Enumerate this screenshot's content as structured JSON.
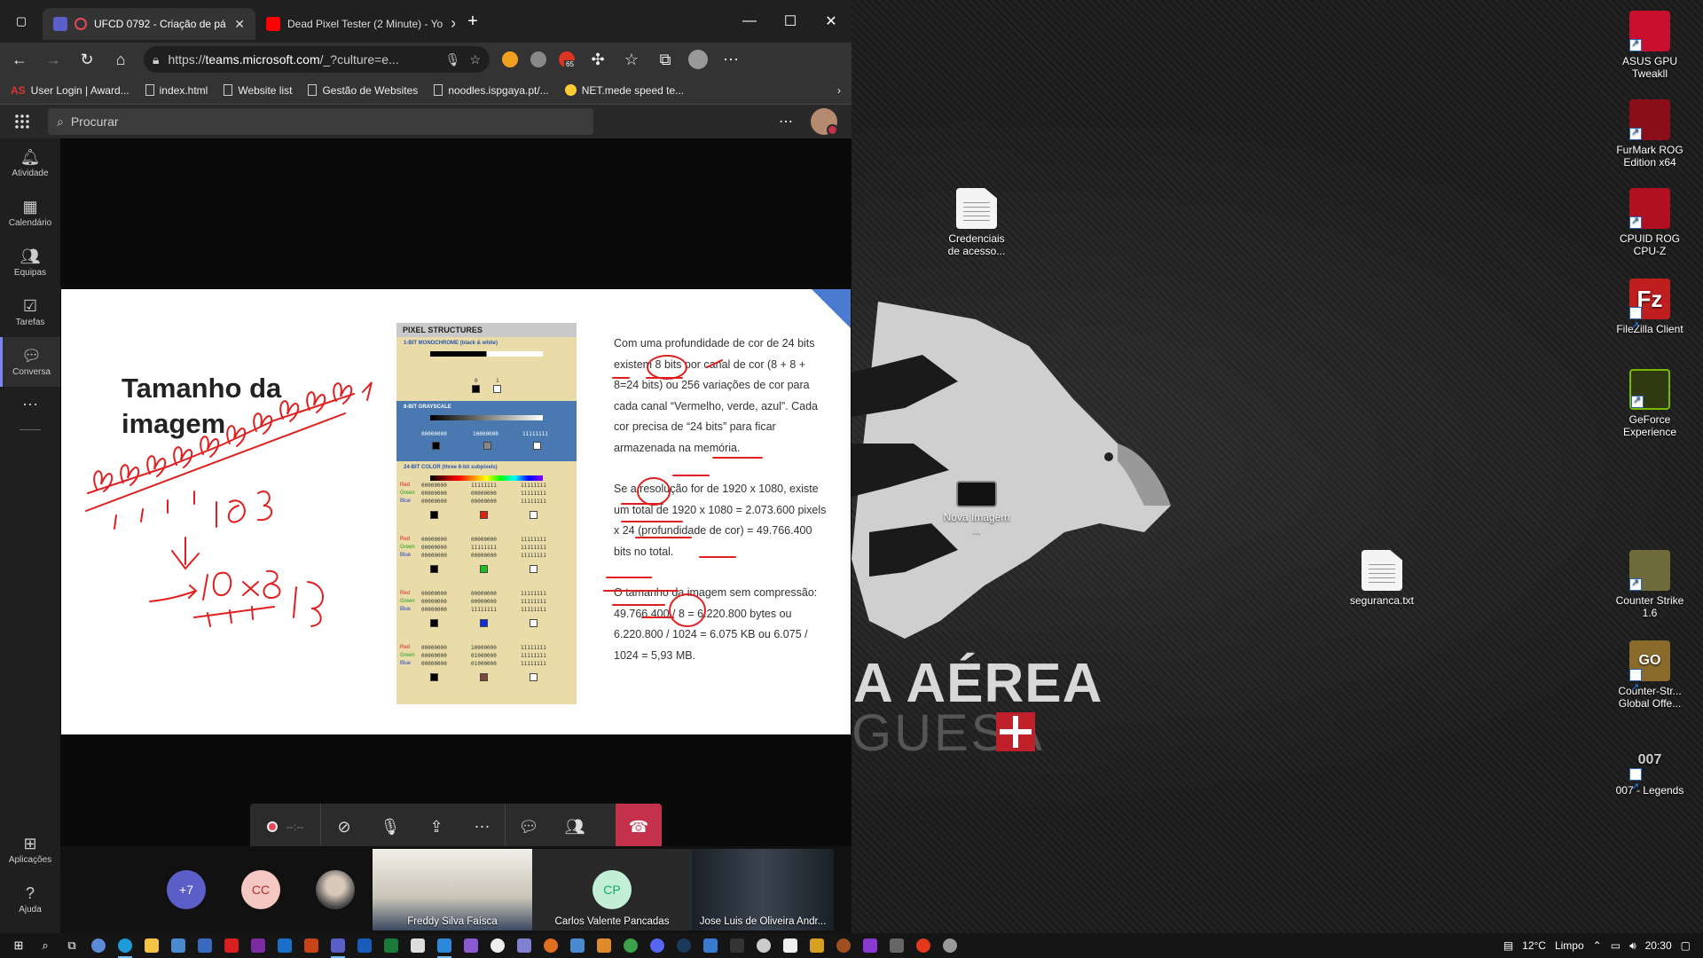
{
  "browser": {
    "tabs": [
      {
        "title": "UFCD 0792 - Criação de pá",
        "active": true
      },
      {
        "title": "Dead Pixel Tester (2 Minute) - Yo",
        "active": false
      }
    ],
    "url_prefix": "https://",
    "url_host": "teams.microsoft.com",
    "url_path": "/_?culture=e...",
    "extension_badge": "65",
    "bookmarks": [
      "User Login | Award...",
      "index.html",
      "Website list",
      "Gestão de Websites",
      "noodles.ispgaya.pt/...",
      "NET.mede speed te..."
    ]
  },
  "teams": {
    "search_placeholder": "Procurar",
    "rail": [
      {
        "label": "Atividade",
        "icon": "bell-icon"
      },
      {
        "label": "Calendário",
        "icon": "calendar-icon"
      },
      {
        "label": "Equipas",
        "icon": "teams-icon"
      },
      {
        "label": "Tarefas",
        "icon": "tasks-icon"
      },
      {
        "label": "Conversa",
        "icon": "chat-icon"
      }
    ],
    "rail_bottom": [
      {
        "label": "Aplicações",
        "icon": "apps-icon"
      },
      {
        "label": "Ajuda",
        "icon": "help-icon"
      }
    ],
    "presenter_name": "Jose Luis de Oliveira Andrade",
    "record_time": "--:--",
    "participants": {
      "overflow": "+7",
      "cc_initials": "CC",
      "cp_initials": "CP",
      "video1_name": "Freddy Silva Faísca",
      "cp_name": "Carlos Valente Pancadas",
      "video2_name": "Jose Luis de Oliveira Andr..."
    }
  },
  "slide": {
    "title": "Tamanho da imagem",
    "pixel_header": "PIXEL STRUCTURES",
    "mono_label": "1-BIT MONOCHROME (black & white)",
    "mono_bits": [
      "0",
      "1"
    ],
    "gray_label": "8-BIT GRAYSCALE",
    "gray_bits": [
      "00000000",
      "10000000",
      "11111111"
    ],
    "color_label": "24-BIT COLOR (three 8-bit subpixels)",
    "channel_labels": [
      "Red",
      "Green",
      "Blue"
    ],
    "color_groups": [
      {
        "cols": [
          [
            "00000000",
            "00000000",
            "00000000"
          ],
          [
            "11111111",
            "00000000",
            "00000000"
          ],
          [
            "11111111",
            "11111111",
            "11111111"
          ]
        ],
        "swatches": [
          "#000000",
          "#e02010",
          "#ffffff"
        ]
      },
      {
        "cols": [
          [
            "00000000",
            "00000000",
            "00000000"
          ],
          [
            "00000000",
            "11111111",
            "00000000"
          ],
          [
            "11111111",
            "11111111",
            "11111111"
          ]
        ],
        "swatches": [
          "#000000",
          "#20c020",
          "#ffffff"
        ]
      },
      {
        "cols": [
          [
            "00000000",
            "00000000",
            "00000000"
          ],
          [
            "00000000",
            "00000000",
            "11111111"
          ],
          [
            "11111111",
            "11111111",
            "11111111"
          ]
        ],
        "swatches": [
          "#000000",
          "#1030e0",
          "#ffffff"
        ]
      },
      {
        "cols": [
          [
            "00000000",
            "00000000",
            "00000000"
          ],
          [
            "10000000",
            "01000000",
            "01000000"
          ],
          [
            "11111111",
            "11111111",
            "11111111"
          ]
        ],
        "swatches": [
          "#000000",
          "#7a4a3a",
          "#ffffff"
        ]
      }
    ],
    "para1": "Com uma profundidade de cor de 24 bits existem 8 bits por canal de cor (8 + 8 + 8=24 bits) ou 256 variações de cor para cada canal “Vermelho, verde, azul”. Cada cor precisa de “24 bits” para ficar armazenada na memória.",
    "para2": "Se a resolução for de 1920 x 1080, existe um total de 1920 x 1080 = 2.073.600 pixels x 24 (profundidade de cor) = 49.766.400 bits no total.",
    "para3": "O tamanho da imagem sem compressão: 49.766.400 / 8 = 6.220.800 bytes ou 6.220.800 / 1024 = 6.075 KB ou 6.075 / 1024 = 5,93 MB."
  },
  "desktop": {
    "icons_right": [
      {
        "label": "ASUS GPU Tweakll",
        "color": "#c8102e"
      },
      {
        "label": "FurMark ROG Edition x64",
        "color": "#8b0d1a"
      },
      {
        "label": "CPUID ROG CPU-Z",
        "color": "#b01020"
      },
      {
        "label": "FileZilla Client",
        "color": "#bf1e1e"
      },
      {
        "label": "GeForce Experience",
        "color": "#3a3a3a"
      },
      {
        "label": "Counter Strike 1.6",
        "color": "#6f6a3a"
      },
      {
        "label": "Counter-Str... Global Offe...",
        "color": "#8a6a2a"
      },
      {
        "label": "007 - Legends",
        "color": "#333333"
      }
    ],
    "file_credenciais": "Credenciais de acesso...",
    "file_nova": "Nova Imagem ...",
    "file_seguranca": "seguranca.txt",
    "wallpaper_line1": "A AÉREA",
    "wallpaper_line2": "GUESA"
  },
  "taskbar": {
    "temp": "12°C",
    "weather": "Limpo",
    "time": "20:30"
  }
}
